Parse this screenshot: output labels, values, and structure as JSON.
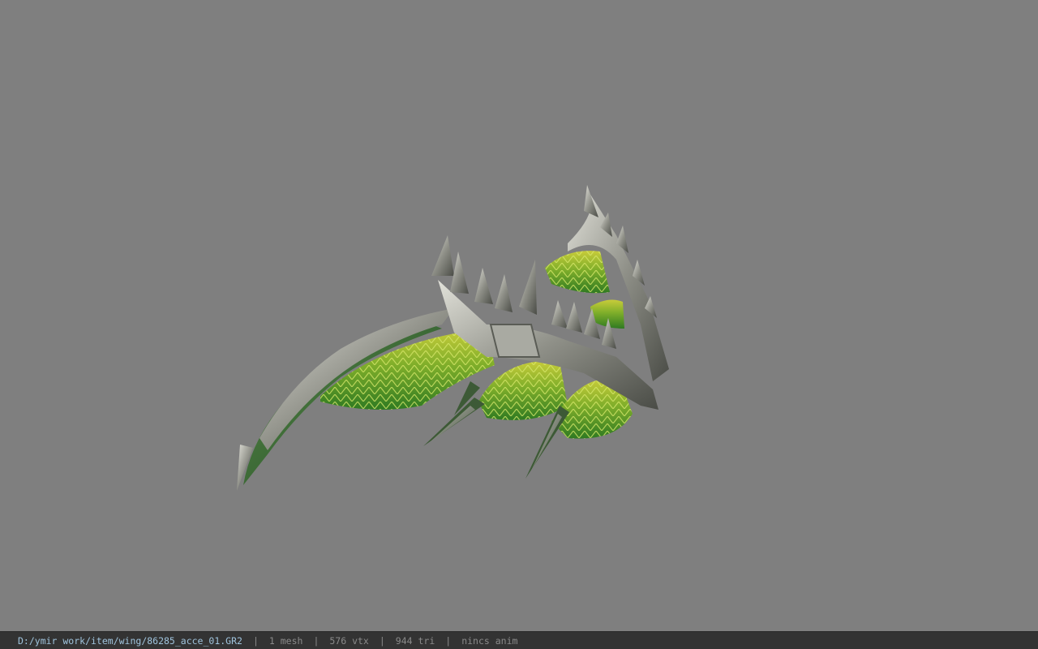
{
  "viewer": {
    "background_color": "#7f7f7f",
    "model_icon": "dragon-wing-model"
  },
  "statusbar": {
    "file_path": "D:/ymir work/item/wing/86285_acce_01.GR2",
    "mesh_count": "1 mesh",
    "vertex_count": "576 vtx",
    "triangle_count": "944 tri",
    "animation_status": "nincs anim",
    "separator": "|",
    "path_color": "#9fc3dc",
    "text_color": "#8a8a8a"
  }
}
